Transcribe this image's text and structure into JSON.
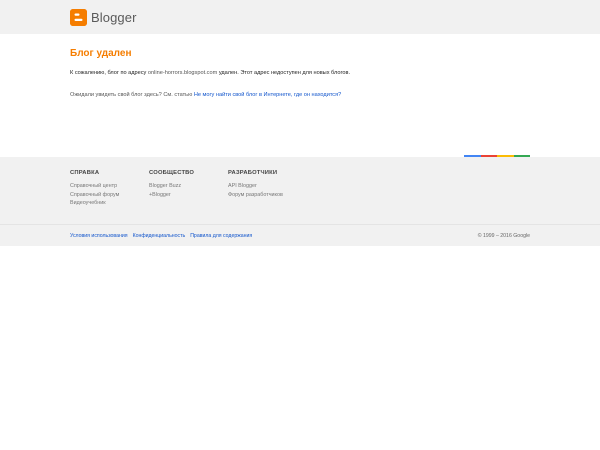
{
  "header": {
    "logo_text": "Blogger"
  },
  "main": {
    "title": "Блог удален",
    "message_prefix": "К сожалению, блог по адресу",
    "blog_address": "online-horrors.blogspot.com",
    "message_suffix": "удален. Этот адрес недоступен для новых блогов.",
    "hint_prefix": "Ожидали увидеть свой блог здесь? См. статью",
    "hint_link": "Не могу найти свой блог в Интернете, где он находится?"
  },
  "colorbar": [
    "#4285f4",
    "#ea4335",
    "#fbbc05",
    "#34a853"
  ],
  "footer": {
    "columns": [
      {
        "heading": "СПРАВКА",
        "links": [
          "Справочный центр",
          "Справочный форум",
          "Видеоучебник"
        ]
      },
      {
        "heading": "СООБЩЕСТВО",
        "links": [
          "Blogger Buzz",
          "+Blogger"
        ]
      },
      {
        "heading": "РАЗРАБОТЧИКИ",
        "links": [
          "API Blogger",
          "Форум разработчиков"
        ]
      }
    ]
  },
  "bottom": {
    "links": [
      "Условия использования",
      "Конфиденциальность",
      "Правила для содержания"
    ],
    "copyright": "© 1999 – 2016 Google"
  }
}
